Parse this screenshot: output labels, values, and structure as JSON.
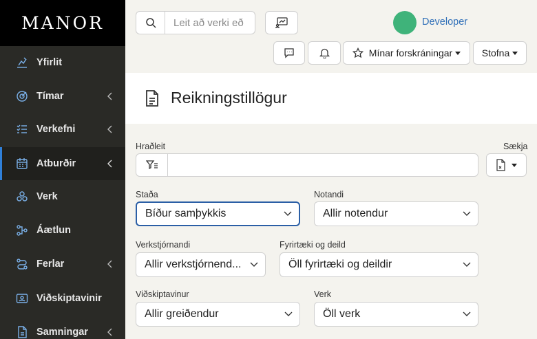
{
  "app": {
    "logo": "MANOR"
  },
  "sidebar": {
    "items": [
      {
        "label": "Yfirlit",
        "icon": "chart-pen-icon"
      },
      {
        "label": "Tímar",
        "icon": "target-clock-icon"
      },
      {
        "label": "Verkefni",
        "icon": "checklist-icon"
      },
      {
        "label": "Atburðir",
        "icon": "calendar-icon"
      },
      {
        "label": "Verk",
        "icon": "cluster-icon"
      },
      {
        "label": "Áætlun",
        "icon": "flow-icon"
      },
      {
        "label": "Ferlar",
        "icon": "route-icon"
      },
      {
        "label": "Viðskiptavinir",
        "icon": "contact-card-icon"
      },
      {
        "label": "Samningar",
        "icon": "document-icon"
      }
    ]
  },
  "topbar": {
    "search_placeholder": "Leit að verki eð",
    "user_name": "Developer",
    "favorites_label": "Mínar forskráningar",
    "create_label": "Stofna"
  },
  "page": {
    "title": "Reikningstillögur"
  },
  "form": {
    "quick_search_label": "Hraðleit",
    "fetch_label": "Sækja",
    "status": {
      "label": "Staða",
      "value": "Bíður samþykkis"
    },
    "user": {
      "label": "Notandi",
      "value": "Allir notendur"
    },
    "foreman": {
      "label": "Verkstjórnandi",
      "value": "Allir verkstjórnend..."
    },
    "company": {
      "label": "Fyrirtæki og deild",
      "value": "Öll fyrirtæki og deildir"
    },
    "customer": {
      "label": "Viðskiptavinur",
      "value": "Allir greiðendur"
    },
    "project": {
      "label": "Verk",
      "value": "Öll verk"
    }
  },
  "colors": {
    "sidebar_bg": "#2a2a26",
    "accent": "#2f7fd8",
    "avatar": "#3fb37a",
    "link": "#2f6fb8"
  }
}
